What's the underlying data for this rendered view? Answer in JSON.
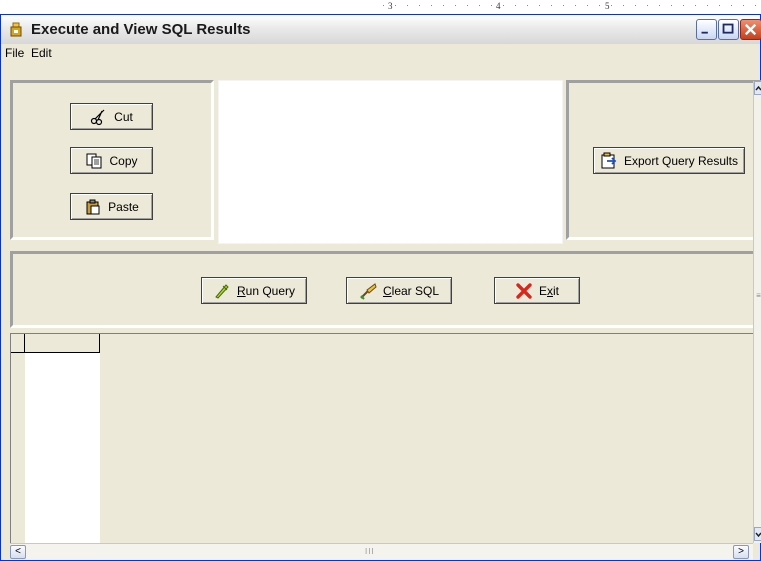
{
  "ruler": {
    "marks": [
      "3",
      "4",
      "5"
    ]
  },
  "window": {
    "title": "Execute and View SQL Results",
    "controls": {
      "minimize": "minimize-icon",
      "maximize": "maximize-icon",
      "close": "close-icon"
    }
  },
  "menu": {
    "items": [
      "File",
      "Edit"
    ]
  },
  "clipboard": {
    "cut": {
      "label": "Cut",
      "icon": "scissors-icon"
    },
    "copy": {
      "label": "Copy",
      "icon": "copy-icon"
    },
    "paste": {
      "label": "Paste",
      "icon": "paste-icon"
    }
  },
  "sql_editor": {
    "value": ""
  },
  "export": {
    "label": "Export Query Results",
    "icon": "export-icon"
  },
  "actions": {
    "run": {
      "label_pre": "",
      "label_ul": "R",
      "label_post": "un Query",
      "icon": "run-icon"
    },
    "clear": {
      "label_pre": "",
      "label_ul": "C",
      "label_post": "lear SQL",
      "icon": "clear-icon"
    },
    "exit": {
      "label_pre": "E",
      "label_ul": "x",
      "label_post": "it",
      "icon": "exit-icon",
      "icon_color": "#d9261c"
    }
  },
  "results_grid": {
    "columns": [
      ""
    ],
    "rows": []
  },
  "scrollbars": {
    "left_arrow": "<",
    "right_arrow": ">",
    "grip": "III"
  }
}
